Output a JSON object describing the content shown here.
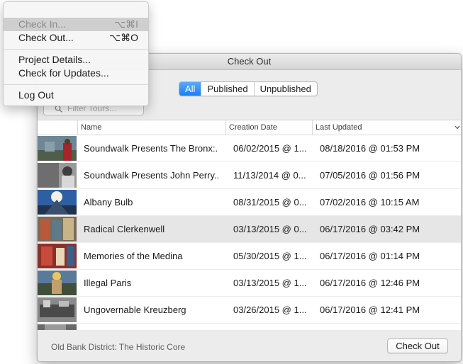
{
  "window": {
    "title": "Check Out"
  },
  "filter_tabs": [
    "All",
    "Published",
    "Unpublished"
  ],
  "search": {
    "placeholder": "Filter Tours..."
  },
  "table": {
    "columns": [
      "Name",
      "Creation Date",
      "Last Updated"
    ],
    "rows": [
      {
        "name": "Soundwalk Presents The Bronx:...",
        "created": "06/02/2015 @ 1...",
        "updated": "08/18/2016 @ 01:53 PM"
      },
      {
        "name": "Soundwalk Presents John Perry...",
        "created": "11/13/2014 @ 0...",
        "updated": "07/05/2016 @ 01:56 PM"
      },
      {
        "name": "Albany Bulb",
        "created": "08/31/2015 @ 0...",
        "updated": "07/02/2016 @ 10:15 AM"
      },
      {
        "name": "Radical Clerkenwell",
        "created": "03/13/2015 @ 0...",
        "updated": "06/17/2016 @ 03:42 PM"
      },
      {
        "name": "Memories of the Medina",
        "created": "05/30/2015 @ 1...",
        "updated": "06/17/2016 @ 01:14 PM"
      },
      {
        "name": "Illegal Paris",
        "created": "03/13/2015 @ 1...",
        "updated": "06/17/2016 @ 12:46 PM"
      },
      {
        "name": "Ungovernable Kreuzberg",
        "created": "03/26/2015 @ 1...",
        "updated": "06/17/2016 @ 12:41 PM"
      }
    ]
  },
  "status_text": "Old Bank District: The Historic Core",
  "checkout_button": "Check Out",
  "menu": {
    "items": [
      {
        "label": "Check In...",
        "shortcut": "⌥⌘I"
      },
      {
        "label": "Check Out...",
        "shortcut": "⌥⌘O"
      },
      {
        "label": "Project Details...",
        "shortcut": ""
      },
      {
        "label": "Check for Updates...",
        "shortcut": ""
      },
      {
        "label": "Log Out",
        "shortcut": ""
      }
    ]
  },
  "colors": {
    "accent": "#1a7ef5",
    "selected_row": "#e6e6e6"
  }
}
